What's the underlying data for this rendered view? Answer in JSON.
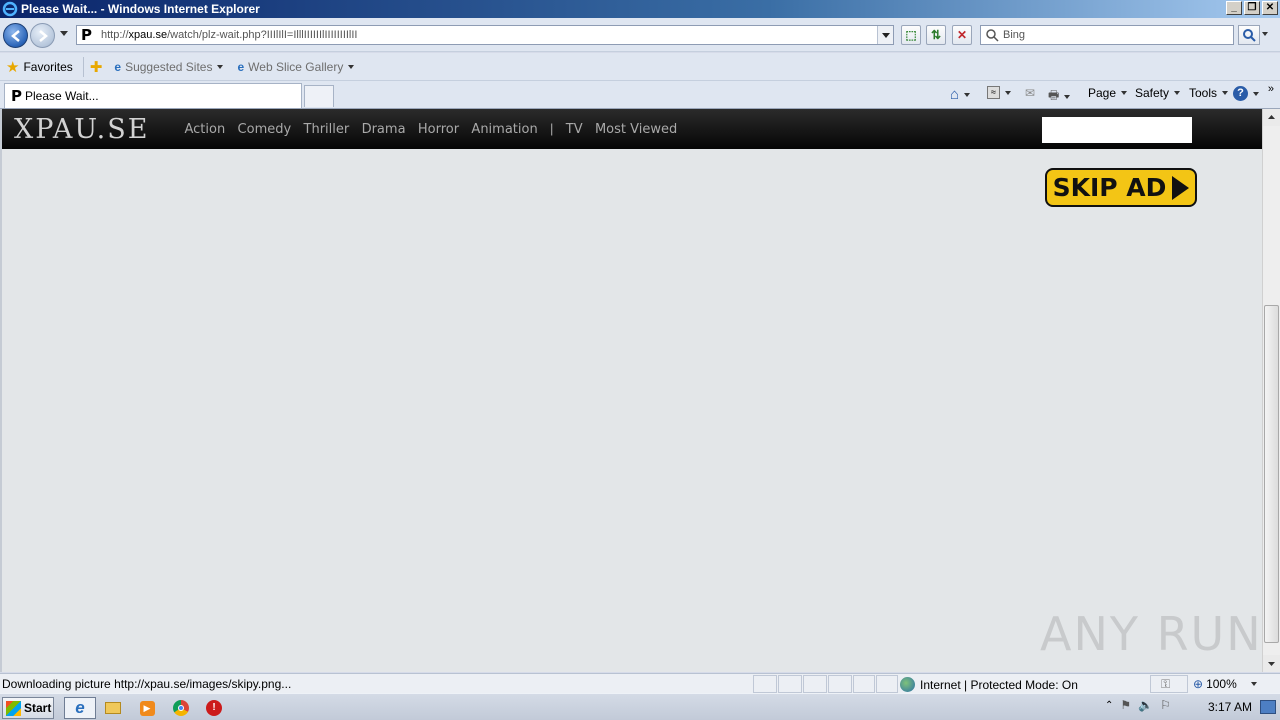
{
  "window": {
    "title": "Please Wait... - Windows Internet Explorer"
  },
  "address_bar": {
    "url_prefix": "http://",
    "url_host": "xpau.se",
    "url_path": "/watch/plz-wait.php?IIIlIlI=IlllIIIIIIlIIIIIIIIlII",
    "favicon": "P"
  },
  "search": {
    "placeholder": "Bing"
  },
  "favorites_bar": {
    "favorites_label": "Favorites",
    "items": [
      {
        "label": "Suggested Sites"
      },
      {
        "label": "Web Slice Gallery"
      }
    ]
  },
  "tabs": [
    {
      "label": "Please Wait...",
      "favicon": "P"
    }
  ],
  "command_bar": {
    "page": "Page",
    "safety": "Safety",
    "tools": "Tools",
    "chevron": "»"
  },
  "site": {
    "logo": "XPAU.SE",
    "nav": [
      "Action",
      "Comedy",
      "Thriller",
      "Drama",
      "Horror",
      "Animation"
    ],
    "separator": "|",
    "nav2": [
      "TV",
      "Most Viewed"
    ],
    "skip_ad": "SKIP AD"
  },
  "watermark": "ANY RUN",
  "status_bar": {
    "text": "Downloading picture http://xpau.se/images/skipy.png...",
    "zone": "Internet | Protected Mode: On",
    "zoom": "100%"
  },
  "taskbar": {
    "start": "Start",
    "clock": "3:17 AM"
  },
  "colors": {
    "site_header": "#0a0a0a",
    "skip_ad_bg": "#f3c515",
    "page_bg": "#e3e6e8"
  }
}
